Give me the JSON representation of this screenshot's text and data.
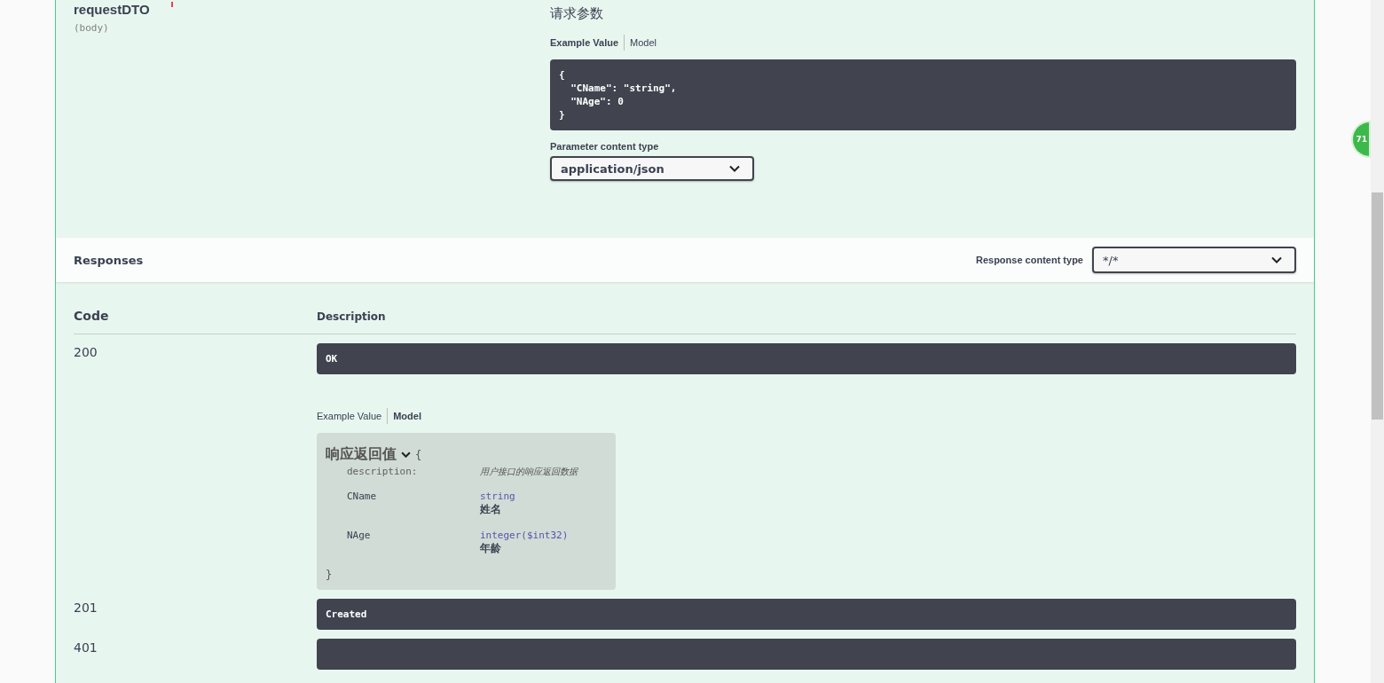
{
  "parameter": {
    "name": "requestDTO",
    "required": true,
    "location": "(body)",
    "description": "请求参数",
    "tabs": [
      {
        "label": "Example Value",
        "selected": true
      },
      {
        "label": "Model",
        "selected": false
      }
    ],
    "example": "{\n  \"CName\": \"string\",\n  \"NAge\": 0\n}",
    "content_type_label": "Parameter content type",
    "content_type": "application/json"
  },
  "responses": {
    "title": "Responses",
    "content_type_label": "Response content type",
    "content_type": "*/*",
    "columns": [
      "Code",
      "Description"
    ],
    "rows": [
      {
        "code": "200",
        "description": "OK",
        "tabs": [
          {
            "label": "Example Value",
            "selected": false
          },
          {
            "label": "Model",
            "selected": true
          }
        ],
        "model": {
          "title": "响应返回值",
          "open_brace": "{",
          "close_brace": "}",
          "description_label": "description:",
          "description": "用户接口的响应返回数据",
          "properties": [
            {
              "name": "CName",
              "type": "string",
              "description": "姓名"
            },
            {
              "name": "NAge",
              "type": "integer($int32)",
              "description": "年龄"
            }
          ]
        }
      },
      {
        "code": "201",
        "description": "Created"
      },
      {
        "code": "401"
      }
    ]
  },
  "badge": "71"
}
